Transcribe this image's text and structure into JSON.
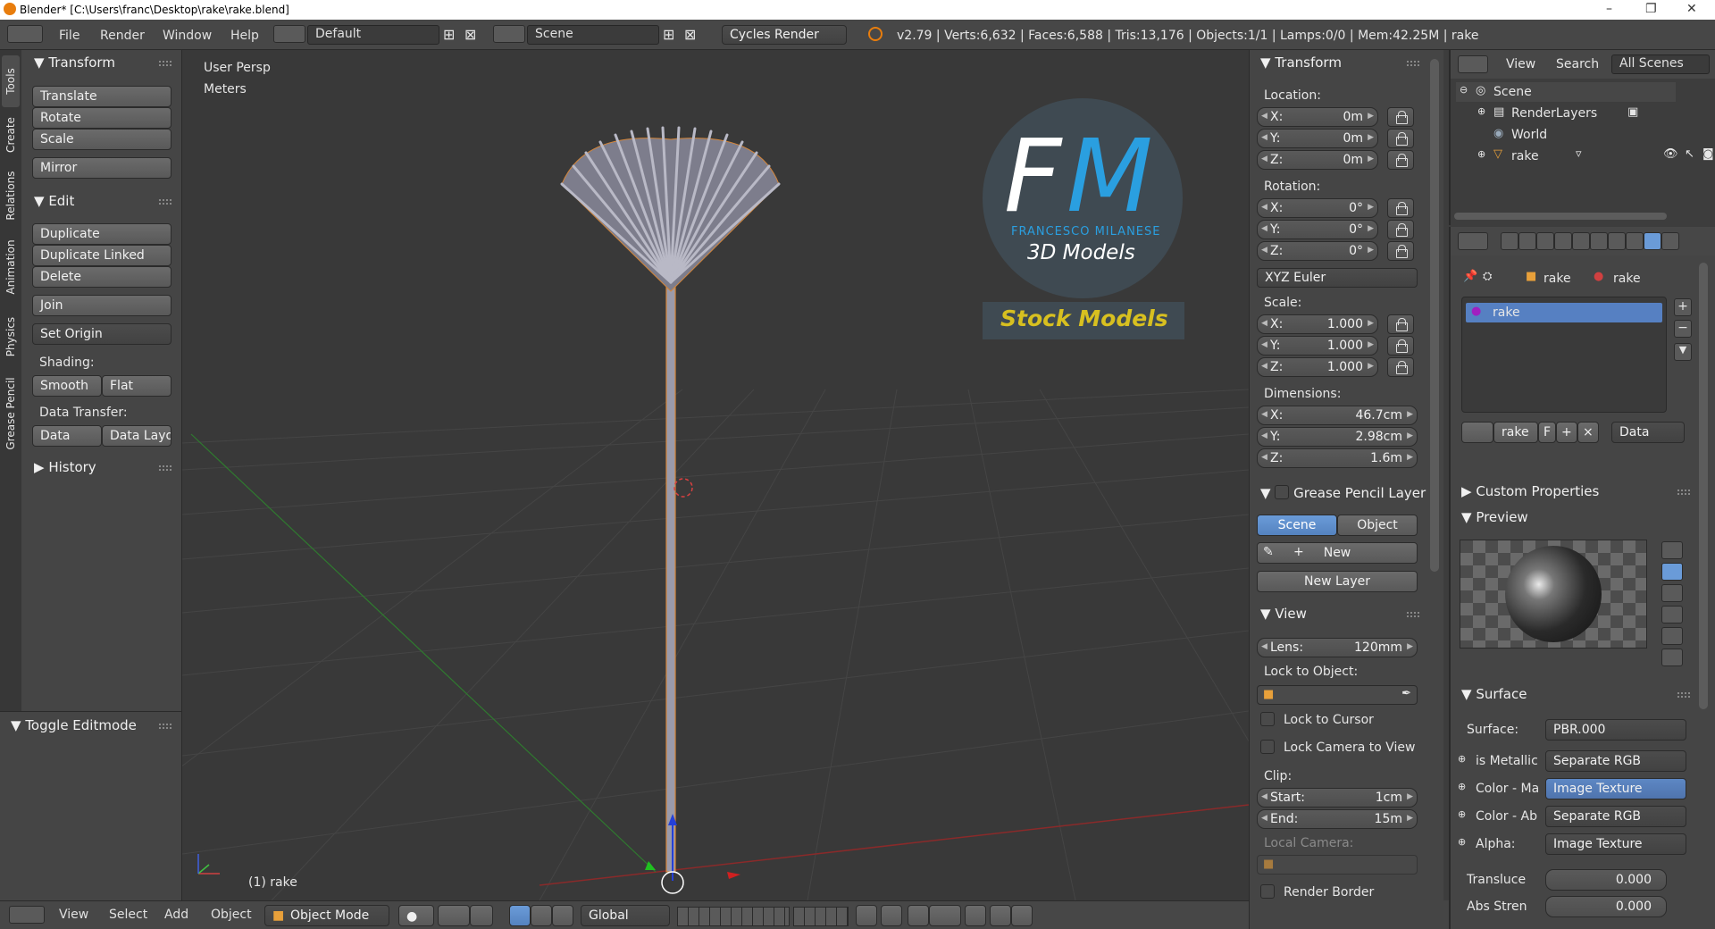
{
  "window": {
    "title": "Blender* [C:\\Users\\franc\\Desktop\\rake\\rake.blend]",
    "controls": [
      "–",
      "❐",
      "✕"
    ]
  },
  "infobar": {
    "menus": [
      "File",
      "Render",
      "Window",
      "Help"
    ],
    "layout": "Default",
    "scene": "Scene",
    "engine": "Cycles Render",
    "stats": "v2.79 | Verts:6,632 | Faces:6,588 | Tris:13,176 | Objects:1/1 | Lamps:0/0 | Mem:42.25M | rake"
  },
  "toolshelf": {
    "tabs": [
      "Tools",
      "Create",
      "Relations",
      "Animation",
      "Physics",
      "Grease Pencil"
    ],
    "transform_title": "Transform",
    "translate": "Translate",
    "rotate": "Rotate",
    "scale": "Scale",
    "mirror": "Mirror",
    "edit_title": "Edit",
    "duplicate": "Duplicate",
    "duplicate_linked": "Duplicate Linked",
    "delete": "Delete",
    "join": "Join",
    "set_origin": "Set Origin",
    "shading_label": "Shading:",
    "smooth": "Smooth",
    "flat": "Flat",
    "data_transfer_label": "Data Transfer:",
    "data": "Data",
    "data_layo": "Data Layo",
    "history": "History",
    "toggle_editmode": "Toggle Editmode"
  },
  "viewport": {
    "view_name": "User Persp",
    "units": "Meters",
    "object_label": "(1) rake",
    "logo": {
      "letters_f": "F",
      "letters_m": "M",
      "brand": "FRANCESCO MILANESE",
      "sub": "3D Models",
      "stock": "Stock Models"
    }
  },
  "props": {
    "transform_title": "Transform",
    "location_label": "Location:",
    "loc": [
      {
        "a": "X:",
        "v": "0m"
      },
      {
        "a": "Y:",
        "v": "0m"
      },
      {
        "a": "Z:",
        "v": "0m"
      }
    ],
    "rotation_label": "Rotation:",
    "rot": [
      {
        "a": "X:",
        "v": "0°"
      },
      {
        "a": "Y:",
        "v": "0°"
      },
      {
        "a": "Z:",
        "v": "0°"
      }
    ],
    "rot_mode": "XYZ Euler",
    "scale_label": "Scale:",
    "scl": [
      {
        "a": "X:",
        "v": "1.000"
      },
      {
        "a": "Y:",
        "v": "1.000"
      },
      {
        "a": "Z:",
        "v": "1.000"
      }
    ],
    "dim_label": "Dimensions:",
    "dim": [
      {
        "a": "X:",
        "v": "46.7cm"
      },
      {
        "a": "Y:",
        "v": "2.98cm"
      },
      {
        "a": "Z:",
        "v": "1.6m"
      }
    ],
    "gp_title": "Grease Pencil Layer",
    "gp_scene": "Scene",
    "gp_object": "Object",
    "gp_new": "New",
    "gp_new_layer": "New Layer",
    "view_title": "View",
    "lens_label": "Lens:",
    "lens_val": "120mm",
    "lock_obj_label": "Lock to Object:",
    "lock_cursor": "Lock to Cursor",
    "lock_camera": "Lock Camera to View",
    "clip_label": "Clip:",
    "clip_start_label": "Start:",
    "clip_start": "1cm",
    "clip_end_label": "End:",
    "clip_end": "15m",
    "local_camera": "Local Camera:",
    "render_border": "Render Border"
  },
  "outliner": {
    "view": "View",
    "search": "Search",
    "filter": "All Scenes",
    "items": [
      "Scene",
      "RenderLayers",
      "World",
      "rake"
    ]
  },
  "properties": {
    "breadcrumb_obj": "rake",
    "breadcrumb_mat": "rake",
    "slot": "rake",
    "mat_name": "rake",
    "mat_f": "F",
    "mat_link": "Data",
    "custom_props": "Custom Properties",
    "preview": "Preview",
    "surface_title": "Surface",
    "surface_label": "Surface:",
    "surface_val": "PBR.000",
    "rows": [
      {
        "label": "is Metallic",
        "val": "Separate RGB",
        "blue": false
      },
      {
        "label": "Color - Ma",
        "val": "Image Texture",
        "blue": true
      },
      {
        "label": "Color - Ab",
        "val": "Separate RGB",
        "blue": false
      },
      {
        "label": "Alpha:",
        "val": "Image Texture",
        "blue": false
      }
    ],
    "transluce_label": "Transluce",
    "transluce_val": "0.000",
    "abs_label": "Abs Stren",
    "abs_val": "0.000"
  },
  "bottombar": {
    "view": "View",
    "select": "Select",
    "add": "Add",
    "object": "Object",
    "mode": "Object Mode",
    "orientation": "Global"
  }
}
